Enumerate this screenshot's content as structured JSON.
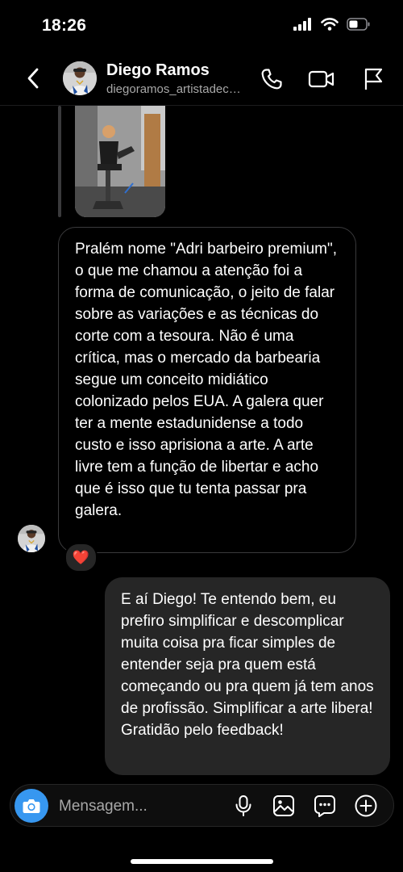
{
  "status_bar": {
    "time": "18:26",
    "icons": [
      "cellular-signal-icon",
      "wifi-icon",
      "battery-icon"
    ]
  },
  "header": {
    "name": "Diego Ramos",
    "handle": "diegoramos_artistadecortes",
    "icons": [
      "back-icon",
      "phone-icon",
      "video-call-icon",
      "flag-icon"
    ]
  },
  "messages": [
    {
      "direction": "incoming",
      "text": "Pralém nome \"Adri barbeiro premium\", o que me chamou a atenção foi a forma de comunicação, o jeito de falar sobre as variações e as técnicas do corte com a tesoura. Não é uma crítica, mas o mercado da barbearia segue um conceito midiático colonizado pelos EUA. A galera quer ter a mente estadunidense a todo custo e isso aprisiona a arte. A arte livre tem a função de libertar e acho que é isso que tu tenta passar pra galera.",
      "reaction": "❤️"
    },
    {
      "direction": "outgoing",
      "text": "E aí Diego! Te entendo bem, eu prefiro simplificar e descomplicar muita coisa pra ficar simples de entender seja pra quem está começando ou pra quem já tem anos de profissão. Simplificar a arte libera! Gratidão pelo feedback!"
    }
  ],
  "composer": {
    "placeholder": "Mensagem...",
    "icons": [
      "camera-icon",
      "microphone-icon",
      "gallery-icon",
      "sticker-icon",
      "plus-icon"
    ]
  },
  "colors": {
    "background": "#000000",
    "outgoing_bubble": "#262626",
    "incoming_border": "#3a3a3c",
    "camera_button": "#3797f0",
    "secondary_text": "#a8a8a8"
  }
}
